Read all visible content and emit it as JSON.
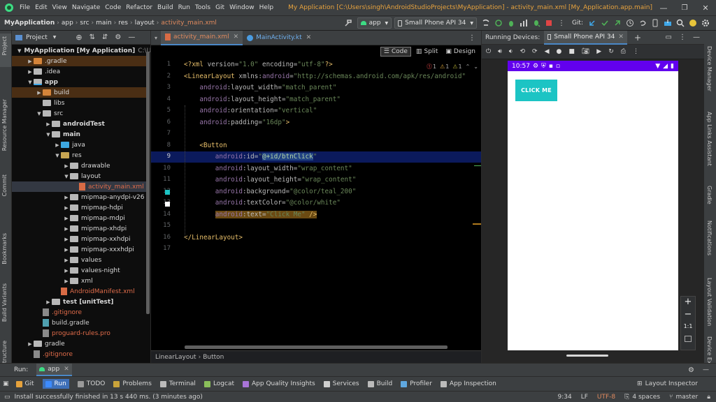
{
  "window": {
    "menu": [
      "File",
      "Edit",
      "View",
      "Navigate",
      "Code",
      "Refactor",
      "Build",
      "Run",
      "Tools",
      "Git",
      "Window",
      "Help"
    ],
    "title": "My Application [C:\\Users\\singh\\AndroidStudioProjects\\MyApplication] - activity_main.xml [My_Application.app.main]"
  },
  "toolbar": {
    "breadcrumb": [
      "MyApplication",
      "app",
      "src",
      "main",
      "res",
      "layout",
      "activity_main.xml"
    ],
    "run_config": "app",
    "device": "Small Phone API 34",
    "git_label": "Git:"
  },
  "left_stripe": [
    "Project",
    "Resource Manager",
    "Commit",
    "Bookmarks",
    "Build Variants",
    "Structure"
  ],
  "right_stripe": [
    "Device Manager",
    "App Links Assistant",
    "Gradle",
    "Notifications",
    "Layout Validation",
    "Device Explorer"
  ],
  "project": {
    "view_label": "Project",
    "tree": [
      {
        "label": "MyApplication",
        "suffix": "[My Application]",
        "path": "C:\\Use",
        "depth": 0,
        "arrow": "open",
        "kind": "module",
        "bold": true
      },
      {
        "label": ".gradle",
        "depth": 1,
        "arrow": "closed",
        "kind": "folder-orange",
        "highlight": "brown"
      },
      {
        "label": ".idea",
        "depth": 1,
        "arrow": "closed",
        "kind": "folder"
      },
      {
        "label": "app",
        "depth": 1,
        "arrow": "open",
        "kind": "module",
        "bold": true
      },
      {
        "label": "build",
        "depth": 2,
        "arrow": "closed",
        "kind": "folder-orange",
        "highlight": "brown"
      },
      {
        "label": "libs",
        "depth": 2,
        "arrow": "",
        "kind": "folder"
      },
      {
        "label": "src",
        "depth": 2,
        "arrow": "open",
        "kind": "folder"
      },
      {
        "label": "androidTest",
        "depth": 3,
        "arrow": "closed",
        "kind": "folder",
        "bold": true
      },
      {
        "label": "main",
        "depth": 3,
        "arrow": "open",
        "kind": "folder",
        "bold": true
      },
      {
        "label": "java",
        "depth": 4,
        "arrow": "closed",
        "kind": "folder-blue"
      },
      {
        "label": "res",
        "depth": 4,
        "arrow": "open",
        "kind": "folder-res"
      },
      {
        "label": "drawable",
        "depth": 5,
        "arrow": "closed",
        "kind": "folder"
      },
      {
        "label": "layout",
        "depth": 5,
        "arrow": "open",
        "kind": "folder"
      },
      {
        "label": "activity_main.xml",
        "depth": 6,
        "arrow": "",
        "kind": "file-xml",
        "color": "#e06c4a",
        "highlight": "grey"
      },
      {
        "label": "mipmap-anydpi-v26",
        "depth": 5,
        "arrow": "closed",
        "kind": "folder"
      },
      {
        "label": "mipmap-hdpi",
        "depth": 5,
        "arrow": "closed",
        "kind": "folder"
      },
      {
        "label": "mipmap-mdpi",
        "depth": 5,
        "arrow": "closed",
        "kind": "folder"
      },
      {
        "label": "mipmap-xhdpi",
        "depth": 5,
        "arrow": "closed",
        "kind": "folder"
      },
      {
        "label": "mipmap-xxhdpi",
        "depth": 5,
        "arrow": "closed",
        "kind": "folder"
      },
      {
        "label": "mipmap-xxxhdpi",
        "depth": 5,
        "arrow": "closed",
        "kind": "folder"
      },
      {
        "label": "values",
        "depth": 5,
        "arrow": "closed",
        "kind": "folder"
      },
      {
        "label": "values-night",
        "depth": 5,
        "arrow": "closed",
        "kind": "folder"
      },
      {
        "label": "xml",
        "depth": 5,
        "arrow": "closed",
        "kind": "folder"
      },
      {
        "label": "AndroidManifest.xml",
        "depth": 4,
        "arrow": "",
        "kind": "file-manifest",
        "color": "#e06c4a"
      },
      {
        "label": "test [unitTest]",
        "depth": 3,
        "arrow": "closed",
        "kind": "folder",
        "bold": true
      },
      {
        "label": ".gitignore",
        "depth": 2,
        "arrow": "",
        "kind": "file",
        "color": "#e06c4a"
      },
      {
        "label": "build.gradle",
        "depth": 2,
        "arrow": "",
        "kind": "file-gradle",
        "color": "#d0d0d0"
      },
      {
        "label": "proguard-rules.pro",
        "depth": 2,
        "arrow": "",
        "kind": "file",
        "color": "#e06c4a"
      },
      {
        "label": "gradle",
        "depth": 1,
        "arrow": "closed",
        "kind": "folder"
      },
      {
        "label": ".gitignore",
        "depth": 1,
        "arrow": "",
        "kind": "file",
        "color": "#e06c4a"
      }
    ]
  },
  "editor": {
    "tabs": [
      {
        "label": "activity_main.xml",
        "active": true
      },
      {
        "label": "MainActivity.kt",
        "active": false
      }
    ],
    "view_modes": [
      "Code",
      "Split",
      "Design"
    ],
    "inspections": {
      "errors": "1",
      "warnings": "1",
      "weak": "1"
    },
    "lines": [
      [
        [
          "<?",
          "tg"
        ],
        [
          "xml ",
          "tg"
        ],
        [
          "version",
          "at"
        ],
        [
          "=",
          "at"
        ],
        [
          "\"1.0\"",
          "vl"
        ],
        [
          " encoding",
          "at"
        ],
        [
          "=",
          "at"
        ],
        [
          "\"utf-8\"",
          "vl"
        ],
        [
          "?>",
          "tg"
        ]
      ],
      [
        [
          "<LinearLayout ",
          "tg"
        ],
        [
          "xmlns:",
          "at"
        ],
        [
          "android",
          "ns"
        ],
        [
          "=",
          "at"
        ],
        [
          "\"http://schemas.android.com/apk/res/android\"",
          "vl"
        ]
      ],
      [
        [
          "    "
        ],
        [
          "android",
          "ns"
        ],
        [
          ":layout_width",
          "at"
        ],
        [
          "=",
          "at"
        ],
        [
          "\"match_parent\"",
          "vl"
        ]
      ],
      [
        [
          "    "
        ],
        [
          "android",
          "ns"
        ],
        [
          ":layout_height",
          "at"
        ],
        [
          "=",
          "at"
        ],
        [
          "\"match_parent\"",
          "vl"
        ]
      ],
      [
        [
          "    "
        ],
        [
          "android",
          "ns"
        ],
        [
          ":orientation",
          "at"
        ],
        [
          "=",
          "at"
        ],
        [
          "\"vertical\"",
          "vl"
        ]
      ],
      [
        [
          "    "
        ],
        [
          "android",
          "ns"
        ],
        [
          ":padding",
          "at"
        ],
        [
          "=",
          "at"
        ],
        [
          "\"16dp\"",
          "vl"
        ],
        [
          ">",
          "tg"
        ]
      ],
      [
        [
          ""
        ]
      ],
      [
        [
          "    "
        ],
        [
          "<Button",
          "tg"
        ]
      ],
      [
        [
          "        "
        ],
        [
          "android",
          "ns"
        ],
        [
          ":id",
          "at"
        ],
        [
          "=",
          "at"
        ],
        [
          "\"",
          "vl"
        ],
        [
          "@+id/btnClick",
          "vl"
        ],
        [
          "\"",
          "vl"
        ]
      ],
      [
        [
          "        "
        ],
        [
          "android",
          "ns"
        ],
        [
          ":layout_width",
          "at"
        ],
        [
          "=",
          "at"
        ],
        [
          "\"wrap_content\"",
          "vl"
        ]
      ],
      [
        [
          "        "
        ],
        [
          "android",
          "ns"
        ],
        [
          ":layout_height",
          "at"
        ],
        [
          "=",
          "at"
        ],
        [
          "\"wrap_content\"",
          "vl"
        ]
      ],
      [
        [
          "        "
        ],
        [
          "android",
          "ns"
        ],
        [
          ":background",
          "at"
        ],
        [
          "=",
          "at"
        ],
        [
          "\"@color/teal_200\"",
          "vl"
        ]
      ],
      [
        [
          "        "
        ],
        [
          "android",
          "ns"
        ],
        [
          ":textColor",
          "at"
        ],
        [
          "=",
          "at"
        ],
        [
          "\"@color/white\"",
          "vl"
        ]
      ],
      [
        [
          "        "
        ],
        [
          "android",
          "ns"
        ],
        [
          ":text",
          "at"
        ],
        [
          "=",
          "at"
        ],
        [
          "\"Click Me\"",
          "vl"
        ],
        [
          " />",
          "tg"
        ]
      ],
      [
        [
          ""
        ]
      ],
      [
        [
          "</LinearLayout>",
          "tg"
        ]
      ],
      [
        [
          ""
        ]
      ]
    ],
    "highlight_line": 9,
    "breadcrumb": [
      "LinearLayout",
      "Button"
    ]
  },
  "devices": {
    "header": "Running Devices:",
    "device_tab": "Small Phone API 34",
    "phone": {
      "time": "10:57",
      "button_label": "CLICK ME"
    },
    "zoom": [
      "+",
      "−",
      "1:1"
    ]
  },
  "run": {
    "label": "Run:",
    "config": "app"
  },
  "tool_windows": [
    {
      "label": "Git",
      "color": "#e6a23c"
    },
    {
      "label": "Run",
      "color": "#3d8bfd",
      "active": true
    },
    {
      "label": "TODO",
      "color": "#9a9a9a"
    },
    {
      "label": "Problems",
      "color": "#c9a33a"
    },
    {
      "label": "Terminal",
      "color": "#bbbbbb"
    },
    {
      "label": "Logcat",
      "color": "#8abf5a"
    },
    {
      "label": "App Quality Insights",
      "color": "#a874d8"
    },
    {
      "label": "Services",
      "color": "#cfcfcf"
    },
    {
      "label": "Build",
      "color": "#bbbbbb"
    },
    {
      "label": "Profiler",
      "color": "#5fa8e0"
    },
    {
      "label": "App Inspection",
      "color": "#bbbbbb"
    }
  ],
  "layout_inspector": "Layout Inspector",
  "status": {
    "message": "Install successfully finished in 13 s 440 ms. (3 minutes ago)",
    "position": "9:34",
    "line_sep": "LF",
    "encoding": "UTF-8",
    "indent": "4 spaces",
    "branch": "master"
  }
}
